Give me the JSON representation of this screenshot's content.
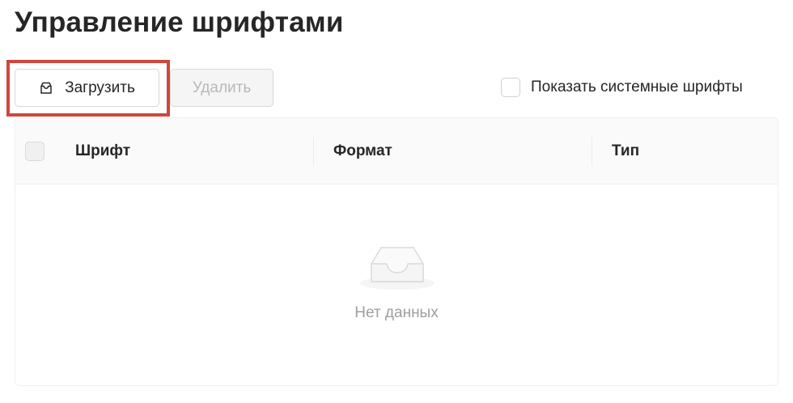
{
  "page": {
    "title": "Управление шрифтами"
  },
  "toolbar": {
    "upload_label": "Загрузить",
    "upload_icon": "upload-tray-icon",
    "delete_label": "Удалить",
    "delete_disabled": true,
    "show_system_fonts_label": "Показать системные шрифты",
    "show_system_fonts_checked": false
  },
  "table": {
    "columns": [
      "Шрифт",
      "Формат",
      "Тип"
    ],
    "rows": [],
    "empty_text": "Нет данных",
    "empty_icon": "empty-inbox-icon"
  },
  "colors": {
    "highlight": "#d0473c",
    "header_bg": "#fafafa",
    "disabled_text": "#b8b8b8",
    "empty_text": "#9e9e9e"
  }
}
